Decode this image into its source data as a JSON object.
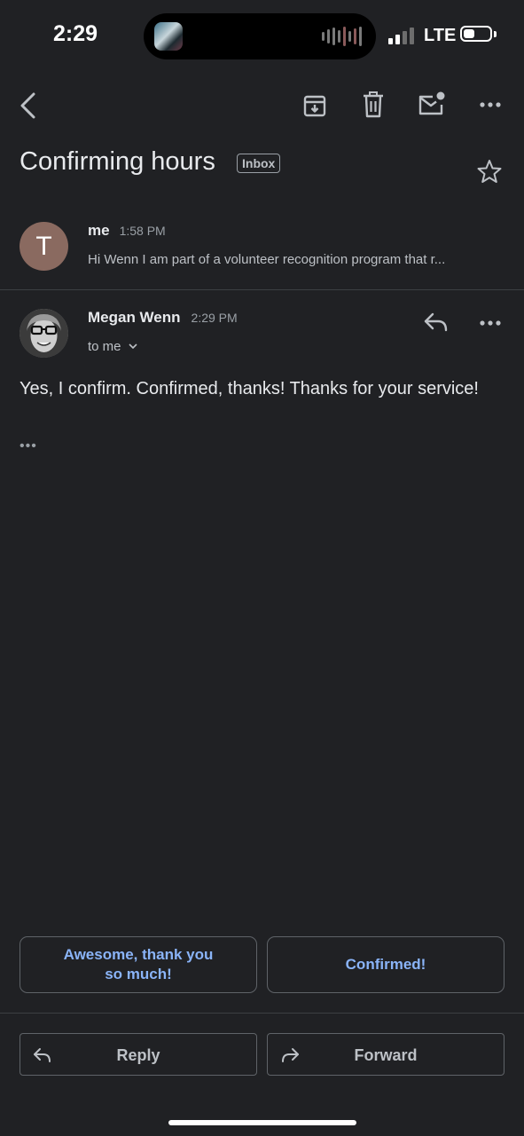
{
  "status_bar": {
    "time": "2:29",
    "network": "LTE"
  },
  "toolbar": {
    "back_icon": "chevron-left-icon",
    "archive_icon": "archive-icon",
    "delete_icon": "trash-icon",
    "mark_unread_icon": "mail-unread-icon",
    "more_icon": "more-horizontal-icon"
  },
  "thread": {
    "subject": "Confirming hours",
    "label": "Inbox",
    "star_icon": "star-outline-icon"
  },
  "messages": [
    {
      "avatar_letter": "T",
      "avatar_color": "#8a6a60",
      "sender": "me",
      "time": "1:58 PM",
      "snippet": "Hi Wenn I am part of a volunteer recognition program that r..."
    },
    {
      "sender": "Megan Wenn",
      "time": "2:29 PM",
      "recipients": "to me",
      "body": "Yes, I confirm. Confirmed, thanks! Thanks for your service!",
      "trimmed_content": "•••"
    }
  ],
  "smart_replies": [
    "Awesome, thank you so much!",
    "Confirmed!"
  ],
  "actions": {
    "reply_label": "Reply",
    "forward_label": "Forward"
  },
  "colors": {
    "background": "#202124",
    "accent": "#8ab4f8",
    "text": "#e8eaed"
  }
}
